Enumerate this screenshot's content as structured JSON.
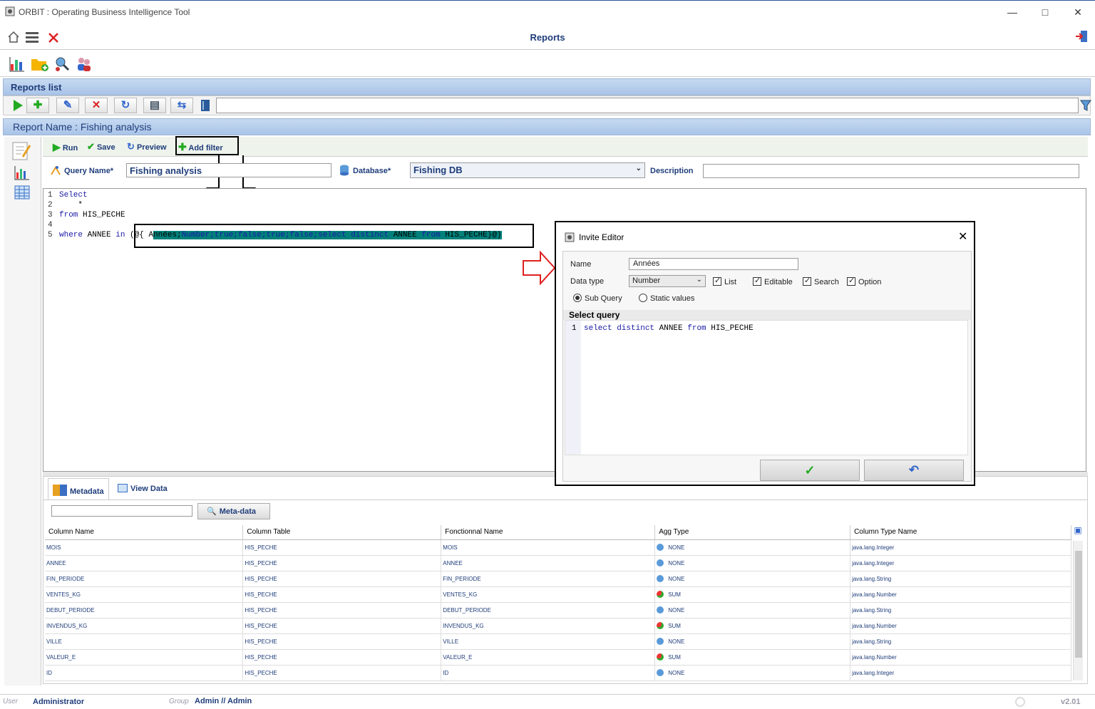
{
  "window": {
    "title": "ORBIT : Operating Business Intelligence Tool"
  },
  "app": {
    "page_title": "Reports"
  },
  "reports_list": {
    "title": "Reports list"
  },
  "report": {
    "name_label": "Report Name : Fishing analysis"
  },
  "editor_toolbar": {
    "run": "Run",
    "save": "Save",
    "preview": "Preview",
    "add_filter": "Add filter"
  },
  "query": {
    "name_label": "Query Name*",
    "name_value": "Fishing analysis",
    "database_label": "Database*",
    "database_value": "Fishing DB",
    "description_label": "Description",
    "description_value": ""
  },
  "code": {
    "line_numbers": [
      "1",
      "2",
      "3",
      "4",
      "5"
    ],
    "l1_kw": "Select",
    "l2": "    *",
    "l3_kw": "from",
    "l3_rest": " HIS_PECHE",
    "l5_kw": "where",
    "l5_mid": " ANNEE ",
    "l5_in": "in",
    "l5_prefix": " (@{ A",
    "l5_hl_a": "nnées;",
    "l5_hl_b": "Number;true;false;true;false;select distinct",
    "l5_hl_c": " ANNEE ",
    "l5_hl_d": "from",
    "l5_hl_e": " HIS_PECHE}@)"
  },
  "bottom": {
    "tab_metadata": "Metadata",
    "tab_viewdata": "View Data",
    "search_value": "",
    "metadata_button": "Meta-data",
    "columns": [
      "Column Name",
      "Column Table",
      "Fonctionnal Name",
      "Agg Type",
      "Column Type Name"
    ],
    "rows": [
      [
        "MOIS",
        "HIS_PECHE",
        "MOIS",
        "NONE",
        "java.lang.Integer"
      ],
      [
        "ANNEE",
        "HIS_PECHE",
        "ANNEE",
        "NONE",
        "java.lang.Integer"
      ],
      [
        "FIN_PERIODE",
        "HIS_PECHE",
        "FIN_PERIODE",
        "NONE",
        "java.lang.String"
      ],
      [
        "VENTES_KG",
        "HIS_PECHE",
        "VENTES_KG",
        "SUM",
        "java.lang.Number"
      ],
      [
        "DEBUT_PERIODE",
        "HIS_PECHE",
        "DEBUT_PERIODE",
        "NONE",
        "java.lang.String"
      ],
      [
        "INVENDUS_KG",
        "HIS_PECHE",
        "INVENDUS_KG",
        "SUM",
        "java.lang.Number"
      ],
      [
        "VILLE",
        "HIS_PECHE",
        "VILLE",
        "NONE",
        "java.lang.String"
      ],
      [
        "VALEUR_E",
        "HIS_PECHE",
        "VALEUR_E",
        "SUM",
        "java.lang.Number"
      ],
      [
        "ID",
        "HIS_PECHE",
        "ID",
        "NONE",
        "java.lang.Integer"
      ]
    ]
  },
  "status": {
    "user_label": "User",
    "user_value": "Administrator",
    "group_label": "Group",
    "group_value": "Admin // Admin",
    "version": "v2.01"
  },
  "dialog": {
    "title": "Invite Editor",
    "name_label": "Name",
    "name_value": "Années",
    "datatype_label": "Data type",
    "datatype_value": "Number",
    "opt_list": "List",
    "opt_editable": "Editable",
    "opt_search": "Search",
    "opt_option": "Option",
    "radio_subquery": "Sub Query",
    "radio_static": "Static values",
    "select_query_label": "Select query",
    "sq_line": "1",
    "sq_kw1": "select distinct",
    "sq_mid": " ANNEE ",
    "sq_kw2": "from",
    "sq_rest": " HIS_PECHE"
  },
  "colors": {
    "accent": "#1f3d7a",
    "section_bar": "#a9c4e8",
    "highlight": "#00807a",
    "annotation_arrow": "#e02020"
  }
}
